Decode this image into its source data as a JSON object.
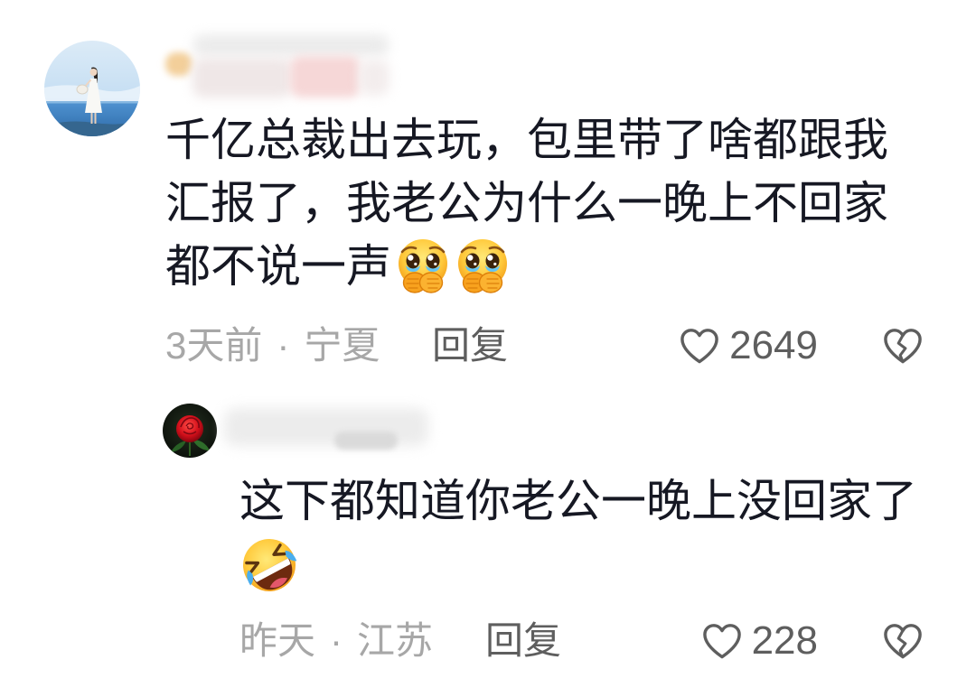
{
  "colors": {
    "text": "#161823",
    "meta": "#a7a7a7",
    "action": "#5e5e5e"
  },
  "icons": {
    "like": "heart-outline",
    "dislike": "broken-heart"
  },
  "separator": "·",
  "comments": [
    {
      "text": "千亿总裁出去玩，包里带了啥都跟我汇报了，我老公为什么一晚上不回家都不说一声",
      "emoji": [
        "pleading-crying-face",
        "pleading-crying-face"
      ],
      "time": "3天前",
      "location": "宁夏",
      "reply_label": "回复",
      "like_count": 2649,
      "replies": [
        {
          "text": "这下都知道你老公一晚上没回家了",
          "emoji": [
            "rolling-on-floor-laughing"
          ],
          "time": "昨天",
          "location": "江苏",
          "reply_label": "回复",
          "like_count": 228
        }
      ]
    }
  ]
}
